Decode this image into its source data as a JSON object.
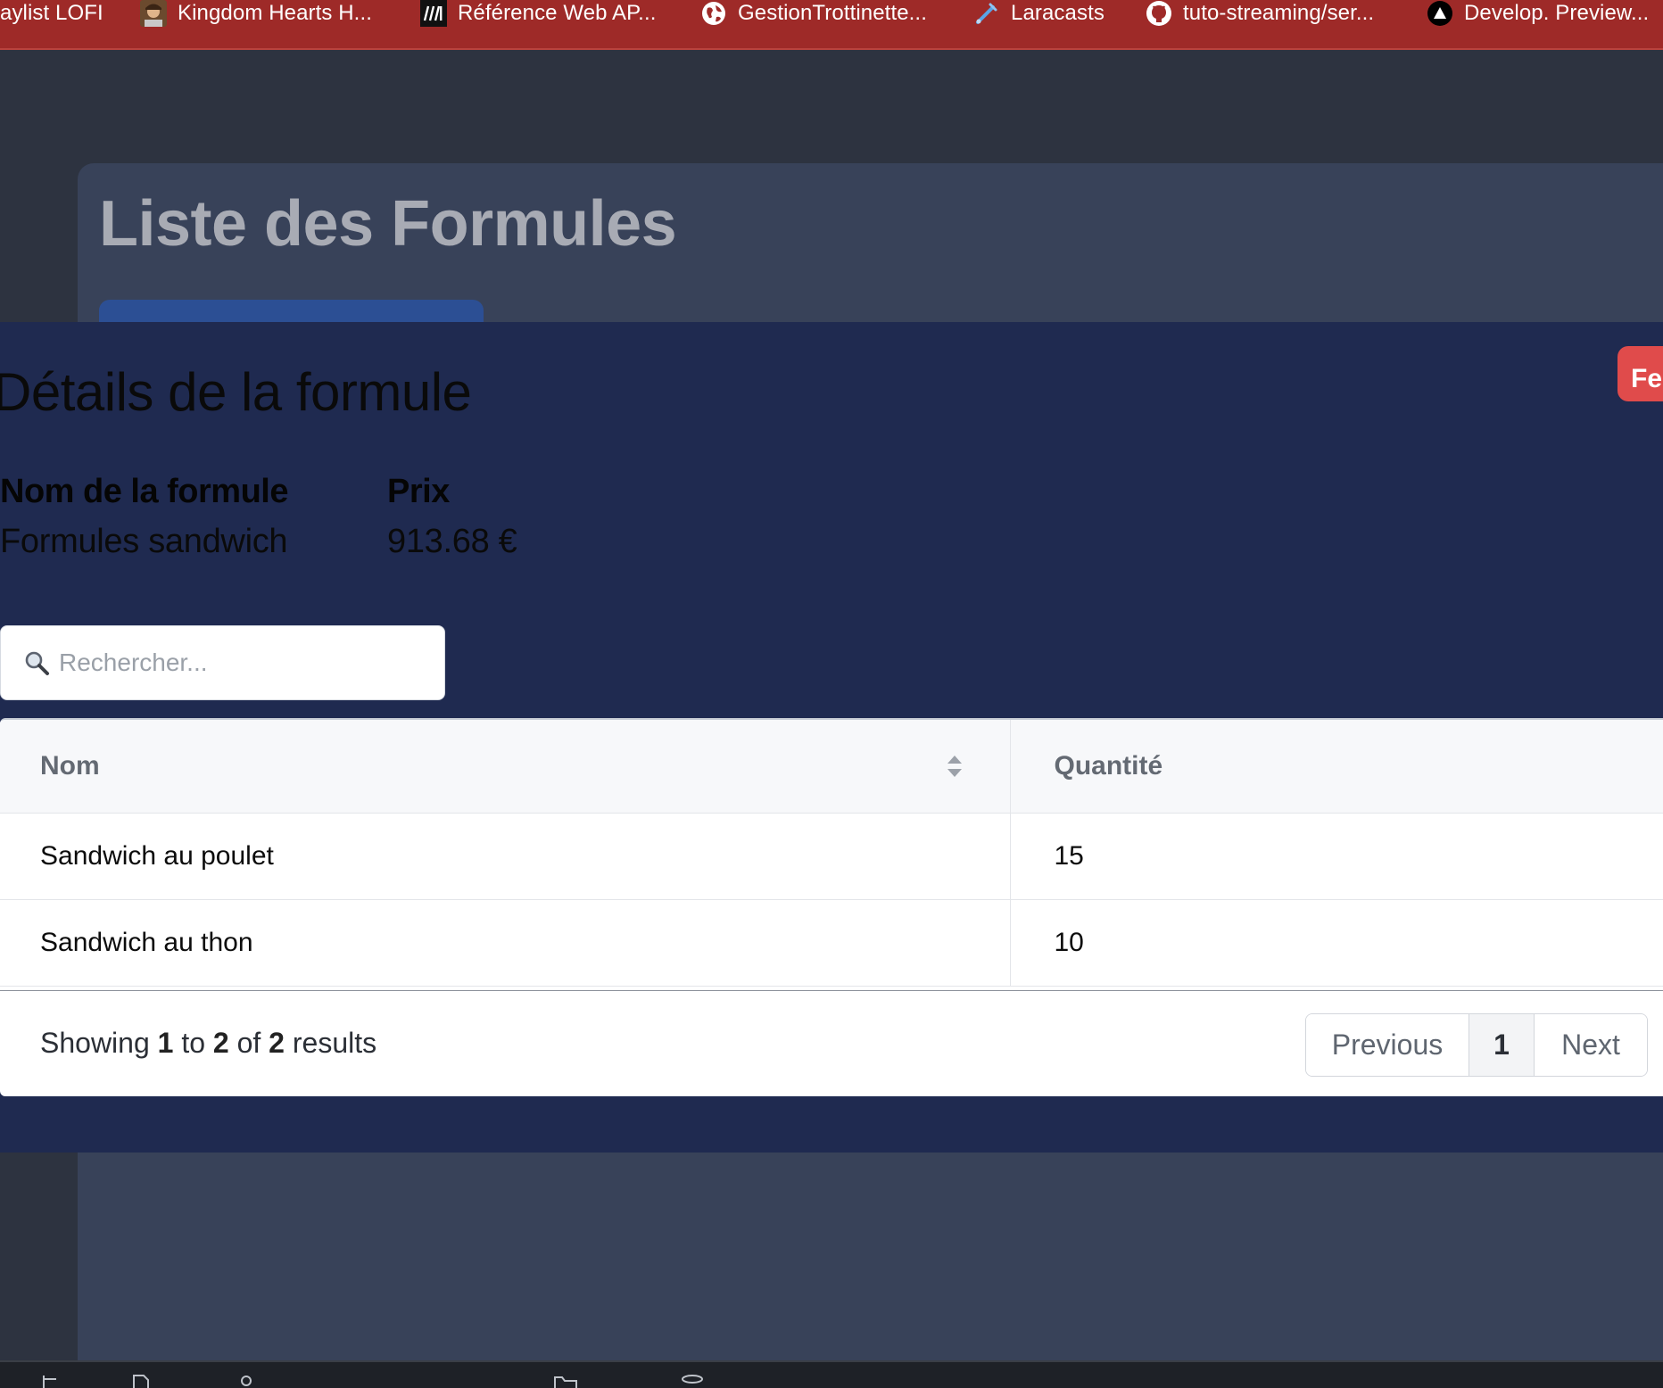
{
  "bookmarks": [
    {
      "label": "aylist LOFI",
      "icon": "none"
    },
    {
      "label": "Kingdom Hearts H...",
      "icon": "avatar-icon"
    },
    {
      "label": "Référence Web AP...",
      "icon": "mdn-logo-icon"
    },
    {
      "label": "GestionTrottinette...",
      "icon": "globe-icon"
    },
    {
      "label": "Laracasts",
      "icon": "laracasts-icon"
    },
    {
      "label": "tuto-streaming/ser...",
      "icon": "github-icon"
    },
    {
      "label": "Develop. Preview...",
      "icon": "triangle-logo-icon"
    }
  ],
  "background_page": {
    "title": "Liste des Formules"
  },
  "modal": {
    "title": "Détails de la formule",
    "close_label": "Fe",
    "details": [
      {
        "label": "Nom de la formule",
        "value": "Formules sandwich"
      },
      {
        "label": "Prix",
        "value": "913.68 €"
      }
    ],
    "search": {
      "placeholder": "Rechercher...",
      "value": ""
    },
    "table": {
      "columns": [
        "Nom",
        "Quantité"
      ],
      "rows": [
        [
          "Sandwich au poulet",
          "15"
        ],
        [
          "Sandwich au thon",
          "10"
        ]
      ]
    },
    "pagination": {
      "showing_prefix": "Showing",
      "from": "1",
      "to_word": "to",
      "to": "2",
      "of_word": "of",
      "total": "2",
      "results_word": "results",
      "previous_label": "Previous",
      "current_page": "1",
      "next_label": "Next"
    }
  },
  "colors": {
    "bookmarks_bar": "#9e2a28",
    "modal_bg": "#1f2a50",
    "close_button": "#e04b4b",
    "page_bg": "#2d3340"
  }
}
